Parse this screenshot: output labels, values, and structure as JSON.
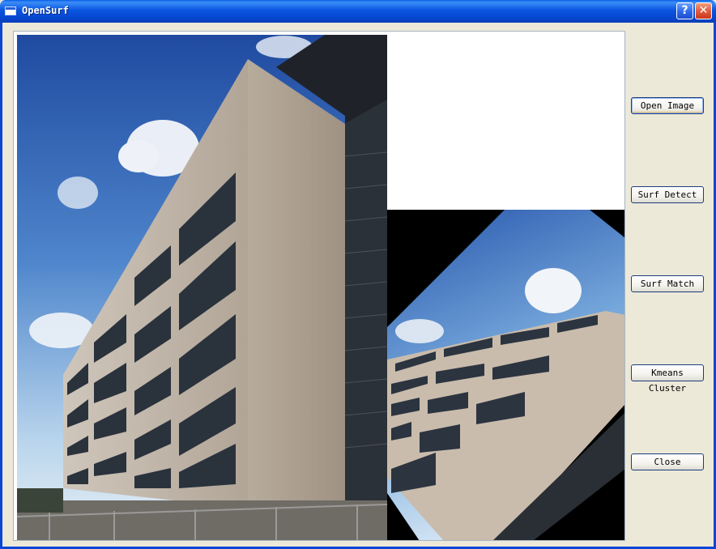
{
  "window": {
    "title": "OpenSurf",
    "help_glyph": "?",
    "close_glyph": "✕"
  },
  "buttons": {
    "open_image": "Open Image",
    "surf_detect": "Surf Detect",
    "surf_match": "Surf Match",
    "kmeans_cluster": "Kmeans Cluster",
    "close": "Close"
  },
  "icons": {
    "app": "window-icon",
    "help": "help-icon",
    "close": "close-icon"
  },
  "colors": {
    "titlebar": "#0a55e0",
    "window_bg": "#ece9d8",
    "close_button": "#e0583a"
  }
}
